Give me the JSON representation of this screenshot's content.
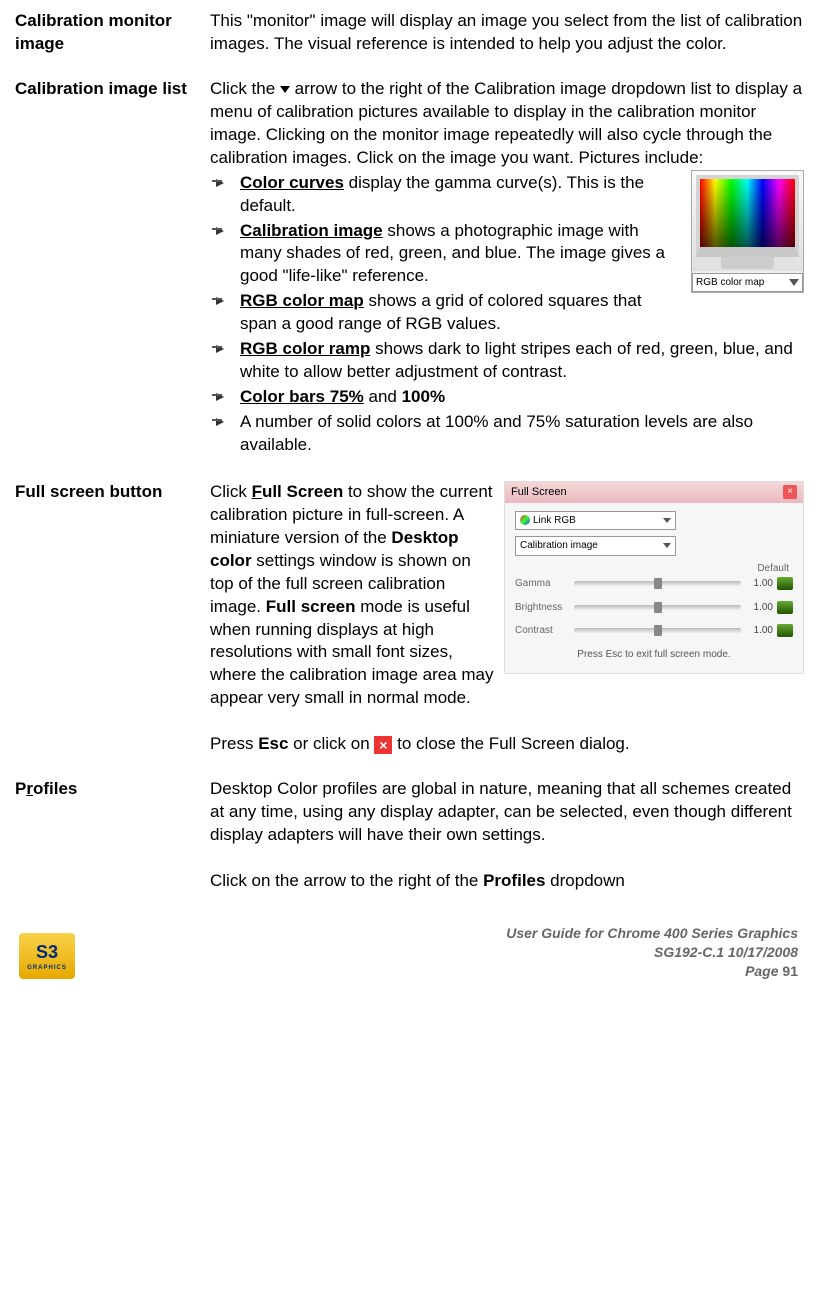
{
  "sections": {
    "calibMonitor": {
      "label": "Calibration monitor image",
      "text": "This \"monitor\" image will display an image you select from the list of calibration images. The visual reference is intended to help you adjust the color."
    },
    "calibList": {
      "label": "Calibration image list",
      "intro1": "Click the ",
      "intro2": " arrow to the right of the Calibration image dropdown list to display a menu of calibration pictures available to display in the calibration monitor image. Clicking on the monitor image repeatedly will also cycle through the calibration images. Click on the image you want. Pictures include:",
      "bullets": {
        "b1a": "Color curves",
        "b1b": " display the gamma curve(s). This is the default.",
        "b2a": "Calibration image",
        "b2b": " shows a photographic image with many shades of red, green, and blue. The image gives a good \"life-like\" reference.",
        "b3a": "RGB color map",
        "b3b": " shows a grid of colored squares that span a good range of RGB values.",
        "b4a": "RGB color ramp",
        "b4b": " shows dark to light stripes each of red, green, blue, and white to allow better adjustment of contrast.",
        "b5a": "Color bars 75%",
        "b5b": " and ",
        "b5c": "100%",
        "b6": "A number of solid colors at 100% and 75% saturation levels are also available."
      },
      "dropdownLabel": "RGB color map"
    },
    "fullScreen": {
      "label": "Full screen button",
      "p1a": "Click ",
      "p1b_underline": "F",
      "p1b_rest": "ull Screen",
      "p1c": " to show the current calibration picture in full-screen. A miniature version of the ",
      "p1d": "Desktop color",
      "p1e": " settings window is shown on top of the full screen calibration image. ",
      "p1f": "Full screen",
      "p1g": " mode is useful when running displays at high resolutions with small font sizes, where the calibration image area may appear very small in normal mode.",
      "p2a": "Press ",
      "p2b": "Esc",
      "p2c": " or click on ",
      "p2d": " to close the Full Screen dialog.",
      "dialog": {
        "title": "Full Screen",
        "link": "Link RGB",
        "calib": "Calibration image",
        "defaultHdr": "Default",
        "gamma": "Gamma",
        "brightness": "Brightness",
        "contrast": "Contrast",
        "val": "1.00",
        "hint": "Press Esc to exit full screen mode."
      }
    },
    "profiles": {
      "label_underline": "r",
      "label_pre": "P",
      "label_post": "ofiles",
      "p1": "Desktop Color profiles are global in nature, meaning that all schemes created at any time, using any display adapter, can be selected, even though different display adapters will have their own settings.",
      "p2a": "Click on the arrow to the right of the ",
      "p2b": "Profiles",
      "p2c": " dropdown"
    }
  },
  "footer": {
    "logo": "S3",
    "logoSub": "GRAPHICS",
    "line1": "User Guide for Chrome 400 Series Graphics",
    "line2": "SG192-C.1   10/17/2008",
    "line3a": "Page ",
    "line3b": "91"
  }
}
